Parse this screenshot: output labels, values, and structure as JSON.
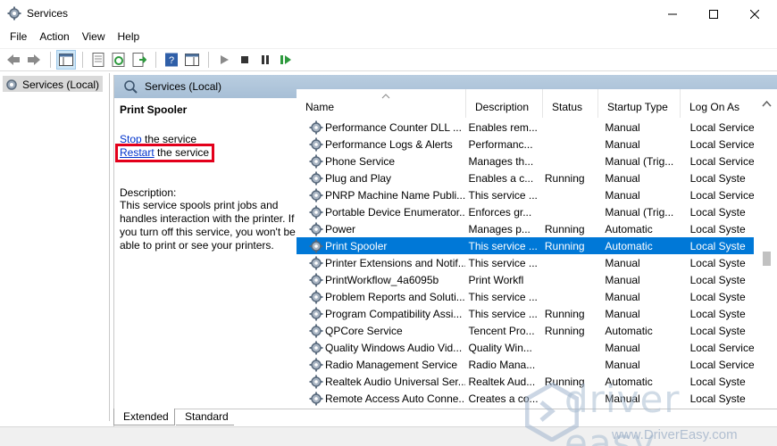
{
  "window": {
    "title": "Services"
  },
  "menu": [
    "File",
    "Action",
    "View",
    "Help"
  ],
  "tree": {
    "item": "Services (Local)"
  },
  "pane_header": "Services (Local)",
  "detail": {
    "service_name": "Print Spooler",
    "stop_link": "Stop",
    "stop_rest": " the service",
    "restart_link": "Restart",
    "restart_rest": " the service",
    "description_label": "Description:",
    "description_text": "This service spools print jobs and handles interaction with the printer. If you turn off this service, you won't be able to print or see your printers."
  },
  "columns": [
    "Name",
    "Description",
    "Status",
    "Startup Type",
    "Log On As"
  ],
  "rows": [
    {
      "name": "Performance Counter DLL ...",
      "desc": "Enables rem...",
      "status": "",
      "startup": "Manual",
      "logon": "Local Service"
    },
    {
      "name": "Performance Logs & Alerts",
      "desc": "Performanc...",
      "status": "",
      "startup": "Manual",
      "logon": "Local Service"
    },
    {
      "name": "Phone Service",
      "desc": "Manages th...",
      "status": "",
      "startup": "Manual (Trig...",
      "logon": "Local Service"
    },
    {
      "name": "Plug and Play",
      "desc": "Enables a c...",
      "status": "Running",
      "startup": "Manual",
      "logon": "Local Syste"
    },
    {
      "name": "PNRP Machine Name Publi...",
      "desc": "This service ...",
      "status": "",
      "startup": "Manual",
      "logon": "Local Service"
    },
    {
      "name": "Portable Device Enumerator...",
      "desc": "Enforces gr...",
      "status": "",
      "startup": "Manual (Trig...",
      "logon": "Local Syste"
    },
    {
      "name": "Power",
      "desc": "Manages p...",
      "status": "Running",
      "startup": "Automatic",
      "logon": "Local Syste"
    },
    {
      "name": "Print Spooler",
      "desc": "This service ...",
      "status": "Running",
      "startup": "Automatic",
      "logon": "Local Syste",
      "selected": true
    },
    {
      "name": "Printer Extensions and Notif...",
      "desc": "This service ...",
      "status": "",
      "startup": "Manual",
      "logon": "Local Syste"
    },
    {
      "name": "PrintWorkflow_4a6095b",
      "desc": "Print Workfl",
      "status": "",
      "startup": "Manual",
      "logon": "Local Syste"
    },
    {
      "name": "Problem Reports and Soluti...",
      "desc": "This service ...",
      "status": "",
      "startup": "Manual",
      "logon": "Local Syste"
    },
    {
      "name": "Program Compatibility Assi...",
      "desc": "This service ...",
      "status": "Running",
      "startup": "Manual",
      "logon": "Local Syste"
    },
    {
      "name": "QPCore Service",
      "desc": "Tencent Pro...",
      "status": "Running",
      "startup": "Automatic",
      "logon": "Local Syste"
    },
    {
      "name": "Quality Windows Audio Vid...",
      "desc": "Quality Win...",
      "status": "",
      "startup": "Manual",
      "logon": "Local Service"
    },
    {
      "name": "Radio Management Service",
      "desc": "Radio Mana...",
      "status": "",
      "startup": "Manual",
      "logon": "Local Service"
    },
    {
      "name": "Realtek Audio Universal Ser...",
      "desc": "Realtek Aud...",
      "status": "Running",
      "startup": "Automatic",
      "logon": "Local Syste"
    },
    {
      "name": "Remote Access Auto Conne...",
      "desc": "Creates a co...",
      "status": "",
      "startup": "Manual",
      "logon": "Local Syste"
    }
  ],
  "tabs": [
    "Extended",
    "Standard"
  ],
  "watermark": {
    "brand": "driver easy",
    "url": "www.DriverEasy.com"
  },
  "colors": {
    "selection": "#0078d7",
    "highlight_box": "#e3001b",
    "link": "#0033cc"
  }
}
